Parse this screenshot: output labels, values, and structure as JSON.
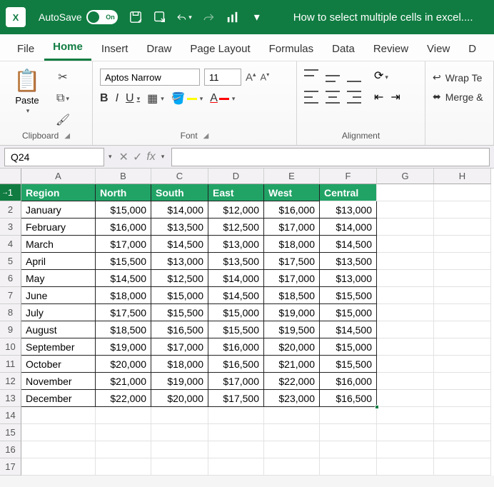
{
  "titlebar": {
    "app_abbrev": "X",
    "autosave_label": "AutoSave",
    "autosave_switch": "On",
    "doc_title": "How to select multiple cells in excel...."
  },
  "tabs": {
    "file": "File",
    "home": "Home",
    "insert": "Insert",
    "draw": "Draw",
    "page_layout": "Page Layout",
    "formulas": "Formulas",
    "data": "Data",
    "review": "Review",
    "view": "View",
    "developer": "D"
  },
  "ribbon": {
    "clipboard": {
      "paste": "Paste",
      "label": "Clipboard"
    },
    "font": {
      "name": "Aptos Narrow",
      "size": "11",
      "bold": "B",
      "italic": "I",
      "underline": "U",
      "label": "Font"
    },
    "alignment": {
      "label": "Alignment"
    },
    "wrap": {
      "wrap": "Wrap Te",
      "merge": "Merge &"
    }
  },
  "formula_bar": {
    "namebox": "Q24",
    "fx": "fx"
  },
  "columns": [
    "A",
    "B",
    "C",
    "D",
    "E",
    "F",
    "G",
    "H"
  ],
  "chart_data": {
    "type": "table",
    "headers": [
      "Region",
      "North",
      "South",
      "East",
      "West",
      "Central"
    ],
    "rows": [
      [
        "January",
        "$15,000",
        "$14,000",
        "$12,000",
        "$16,000",
        "$13,000"
      ],
      [
        "February",
        "$16,000",
        "$13,500",
        "$12,500",
        "$17,000",
        "$14,000"
      ],
      [
        "March",
        "$17,000",
        "$14,500",
        "$13,000",
        "$18,000",
        "$14,500"
      ],
      [
        "April",
        "$15,500",
        "$13,000",
        "$13,500",
        "$17,500",
        "$13,500"
      ],
      [
        "May",
        "$14,500",
        "$12,500",
        "$14,000",
        "$17,000",
        "$13,000"
      ],
      [
        "June",
        "$18,000",
        "$15,000",
        "$14,500",
        "$18,500",
        "$15,500"
      ],
      [
        "July",
        "$17,500",
        "$15,500",
        "$15,000",
        "$19,000",
        "$15,000"
      ],
      [
        "August",
        "$18,500",
        "$16,500",
        "$15,500",
        "$19,500",
        "$14,500"
      ],
      [
        "September",
        "$19,000",
        "$17,000",
        "$16,000",
        "$20,000",
        "$15,000"
      ],
      [
        "October",
        "$20,000",
        "$18,000",
        "$16,500",
        "$21,000",
        "$15,500"
      ],
      [
        "November",
        "$21,000",
        "$19,000",
        "$17,000",
        "$22,000",
        "$16,000"
      ],
      [
        "December",
        "$22,000",
        "$20,000",
        "$17,500",
        "$23,000",
        "$16,500"
      ]
    ]
  },
  "row_numbers": [
    "1",
    "2",
    "3",
    "4",
    "5",
    "6",
    "7",
    "8",
    "9",
    "10",
    "11",
    "12",
    "13",
    "14",
    "15",
    "16",
    "17"
  ]
}
